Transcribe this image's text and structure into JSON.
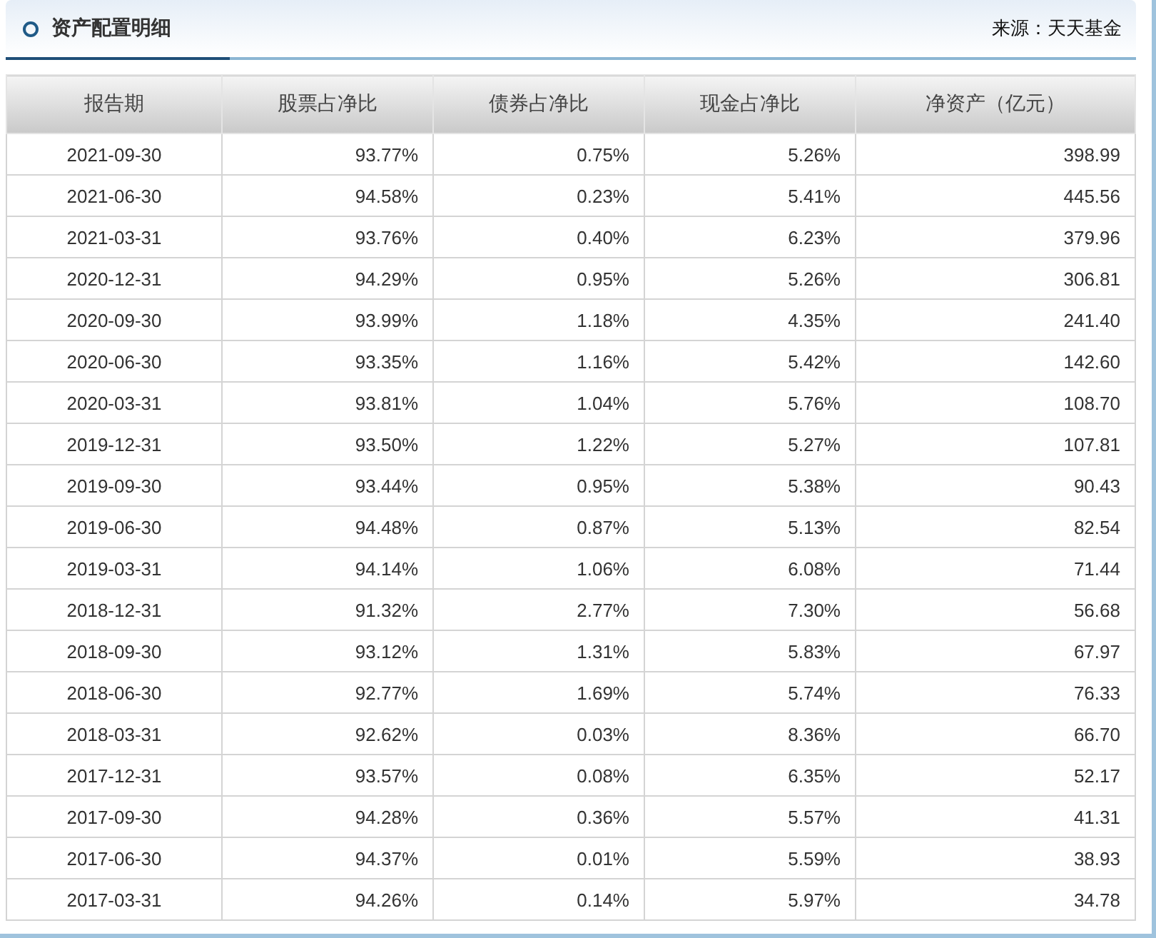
{
  "panel": {
    "title": "资产配置明细",
    "source": "来源：天天基金"
  },
  "table": {
    "columns": [
      "报告期",
      "股票占净比",
      "债券占净比",
      "现金占净比",
      "净资产（亿元）"
    ],
    "rows": [
      [
        "2021-09-30",
        "93.77%",
        "0.75%",
        "5.26%",
        "398.99"
      ],
      [
        "2021-06-30",
        "94.58%",
        "0.23%",
        "5.41%",
        "445.56"
      ],
      [
        "2021-03-31",
        "93.76%",
        "0.40%",
        "6.23%",
        "379.96"
      ],
      [
        "2020-12-31",
        "94.29%",
        "0.95%",
        "5.26%",
        "306.81"
      ],
      [
        "2020-09-30",
        "93.99%",
        "1.18%",
        "4.35%",
        "241.40"
      ],
      [
        "2020-06-30",
        "93.35%",
        "1.16%",
        "5.42%",
        "142.60"
      ],
      [
        "2020-03-31",
        "93.81%",
        "1.04%",
        "5.76%",
        "108.70"
      ],
      [
        "2019-12-31",
        "93.50%",
        "1.22%",
        "5.27%",
        "107.81"
      ],
      [
        "2019-09-30",
        "93.44%",
        "0.95%",
        "5.38%",
        "90.43"
      ],
      [
        "2019-06-30",
        "94.48%",
        "0.87%",
        "5.13%",
        "82.54"
      ],
      [
        "2019-03-31",
        "94.14%",
        "1.06%",
        "6.08%",
        "71.44"
      ],
      [
        "2018-12-31",
        "91.32%",
        "2.77%",
        "7.30%",
        "56.68"
      ],
      [
        "2018-09-30",
        "93.12%",
        "1.31%",
        "5.83%",
        "67.97"
      ],
      [
        "2018-06-30",
        "92.77%",
        "1.69%",
        "5.74%",
        "76.33"
      ],
      [
        "2018-03-31",
        "92.62%",
        "0.03%",
        "8.36%",
        "66.70"
      ],
      [
        "2017-12-31",
        "93.57%",
        "0.08%",
        "6.35%",
        "52.17"
      ],
      [
        "2017-09-30",
        "94.28%",
        "0.36%",
        "5.57%",
        "41.31"
      ],
      [
        "2017-06-30",
        "94.37%",
        "0.01%",
        "5.59%",
        "38.93"
      ],
      [
        "2017-03-31",
        "94.26%",
        "0.14%",
        "5.97%",
        "34.78"
      ]
    ]
  }
}
